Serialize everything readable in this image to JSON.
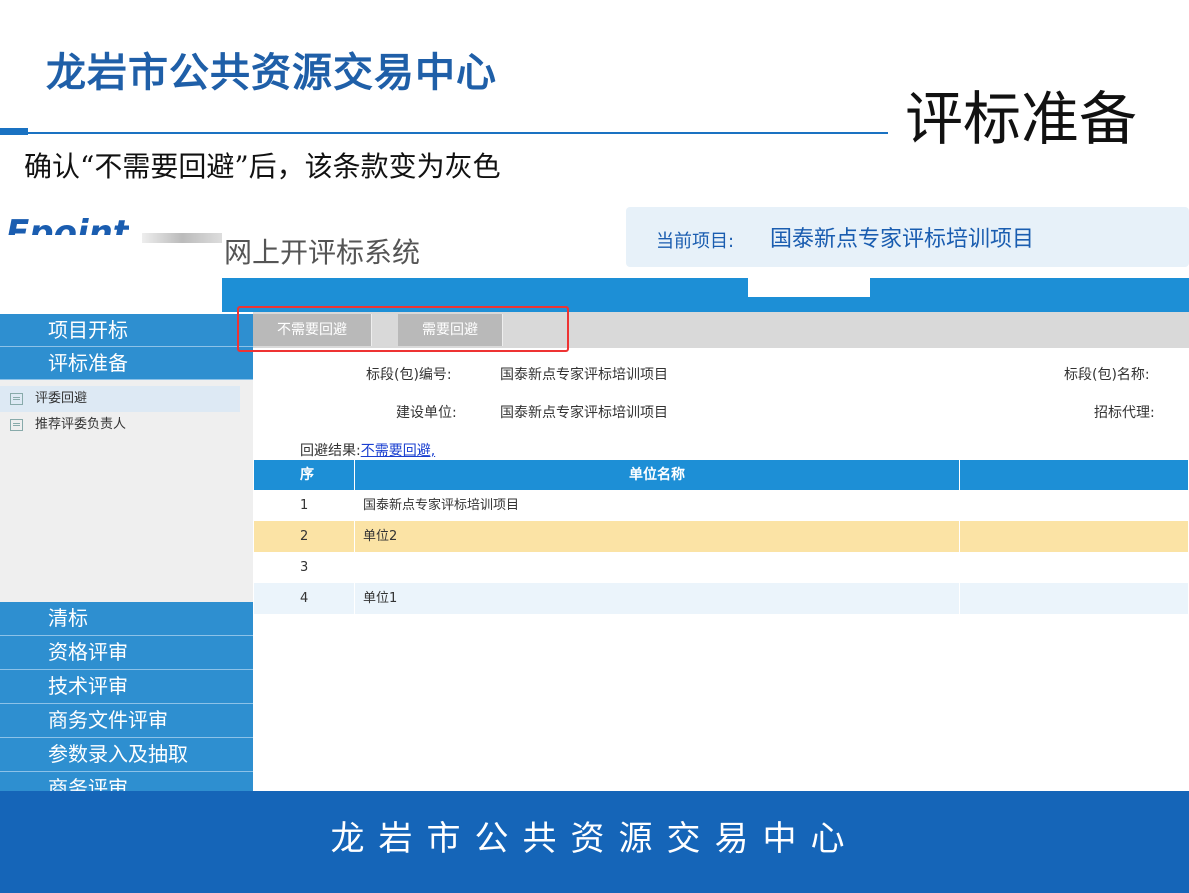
{
  "slide": {
    "title": "龙岩市公共资源交易中心",
    "section": "评标准备",
    "note": "确认“不需要回避”后，该条款变为灰色",
    "footer": "龙岩市公共资源交易中心"
  },
  "app": {
    "logo": "Epoint",
    "system_title": "网上开评标系统",
    "project_label": "当前项目:",
    "project_name": "国泰新点专家评标培训项目"
  },
  "sidebar": {
    "top_items": [
      {
        "label": "项目开标"
      },
      {
        "label": "评标准备"
      }
    ],
    "sub_items": [
      {
        "label": "评委回避",
        "icon": "document-icon"
      },
      {
        "label": "推荐评委负责人",
        "icon": "document-icon"
      }
    ],
    "bottom_items": [
      {
        "label": "清标"
      },
      {
        "label": "资格评审"
      },
      {
        "label": "技术评审"
      },
      {
        "label": "商务文件评审"
      },
      {
        "label": "参数录入及抽取"
      },
      {
        "label": "商务评审"
      }
    ]
  },
  "toolbar": {
    "no_avoid": "不需要回避",
    "need_avoid": "需要回避"
  },
  "form": {
    "section_no_label": "标段(包)编号:",
    "section_no_value": "国泰新点专家评标培训项目",
    "section_name_label": "标段(包)名称:",
    "builder_label": "建设单位:",
    "builder_value": "国泰新点专家评标培训项目",
    "agent_label": "招标代理:",
    "avoid_result_label": "回避结果:",
    "avoid_result_value": "不需要回避,"
  },
  "table": {
    "headers": {
      "seq": "序",
      "unit": "单位名称"
    },
    "rows": [
      {
        "seq": "1",
        "unit": "国泰新点专家评标培训项目"
      },
      {
        "seq": "2",
        "unit": "单位2"
      },
      {
        "seq": "3",
        "unit": ""
      },
      {
        "seq": "4",
        "unit": "单位1"
      }
    ]
  },
  "colors": {
    "accent": "#1d8fd6",
    "highlight_row": "#fbe3a5",
    "highlight_box": "#e33333",
    "footer": "#1565b8"
  }
}
